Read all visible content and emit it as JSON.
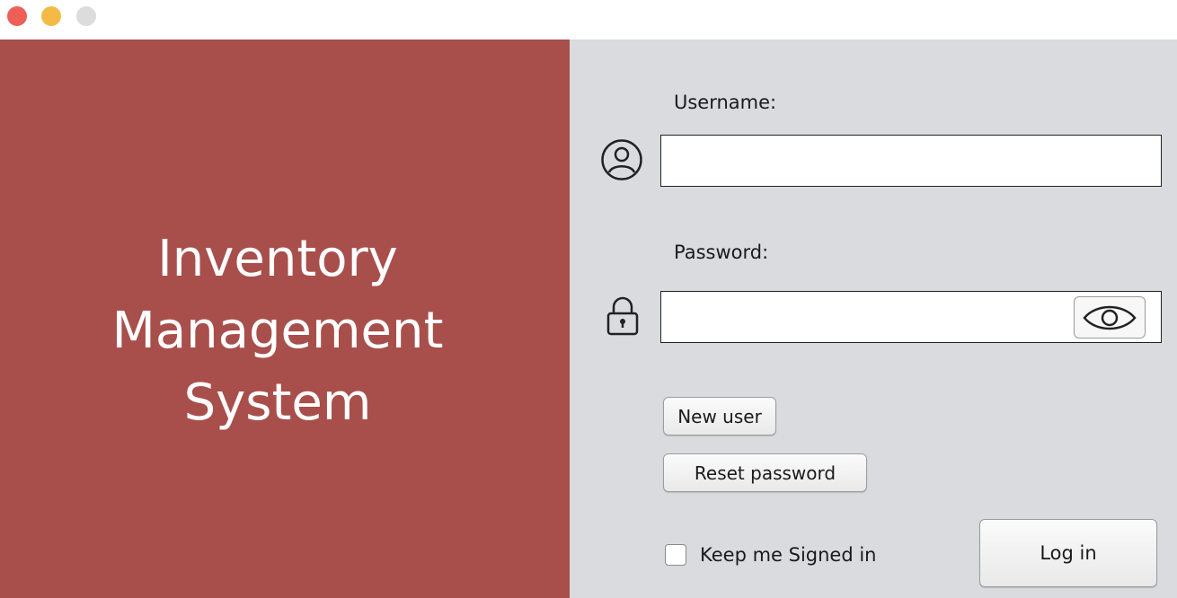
{
  "window": {
    "controls": [
      "close",
      "minimize",
      "maximize"
    ]
  },
  "branding": {
    "title": "Inventory\nManagement\nSystem",
    "panel_color": "#a84f4c"
  },
  "form": {
    "username_label": "Username:",
    "username_value": "",
    "password_label": "Password:",
    "password_value": "",
    "user_icon": "user-circle-icon",
    "lock_icon": "lock-icon",
    "toggle_icon": "eye-icon"
  },
  "actions": {
    "new_user_label": "New user",
    "reset_password_label": "Reset password",
    "keep_signed_in_label": "Keep me Signed in",
    "keep_signed_in_checked": false,
    "login_label": "Log in"
  }
}
